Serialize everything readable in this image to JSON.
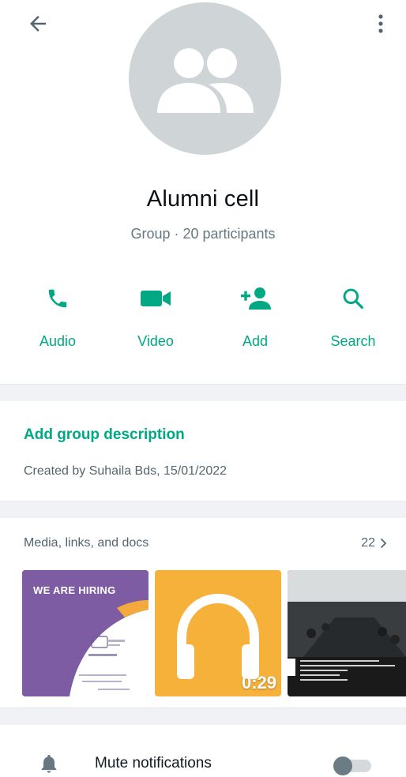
{
  "header": {
    "back_icon": "arrow-left-icon",
    "more_icon": "more-vertical-icon"
  },
  "group": {
    "name": "Alumni cell",
    "subtitle": "Group · 20 participants",
    "avatar_icon": "group-icon"
  },
  "actions": [
    {
      "label": "Audio",
      "icon": "phone-icon"
    },
    {
      "label": "Video",
      "icon": "videocam-icon"
    },
    {
      "label": "Add",
      "icon": "add-person-icon"
    },
    {
      "label": "Search",
      "icon": "search-icon"
    }
  ],
  "description": {
    "link_label": "Add group description",
    "created_text": "Created by Suhaila Bds, 15/01/2022"
  },
  "media": {
    "title": "Media, links, and docs",
    "count": "22",
    "items": [
      {
        "kind": "image",
        "caption": "WE ARE HIRING"
      },
      {
        "kind": "audio",
        "duration": "0:29",
        "icon": "headphones-icon"
      },
      {
        "kind": "image"
      }
    ]
  },
  "mute": {
    "label": "Mute notifications",
    "icon": "bell-icon",
    "enabled": false
  },
  "colors": {
    "accent": "#00a884",
    "avatar_bg": "#cfd4d6",
    "audio_thumb": "#f6b13b",
    "hiring_thumb": "#7e5ca3"
  }
}
